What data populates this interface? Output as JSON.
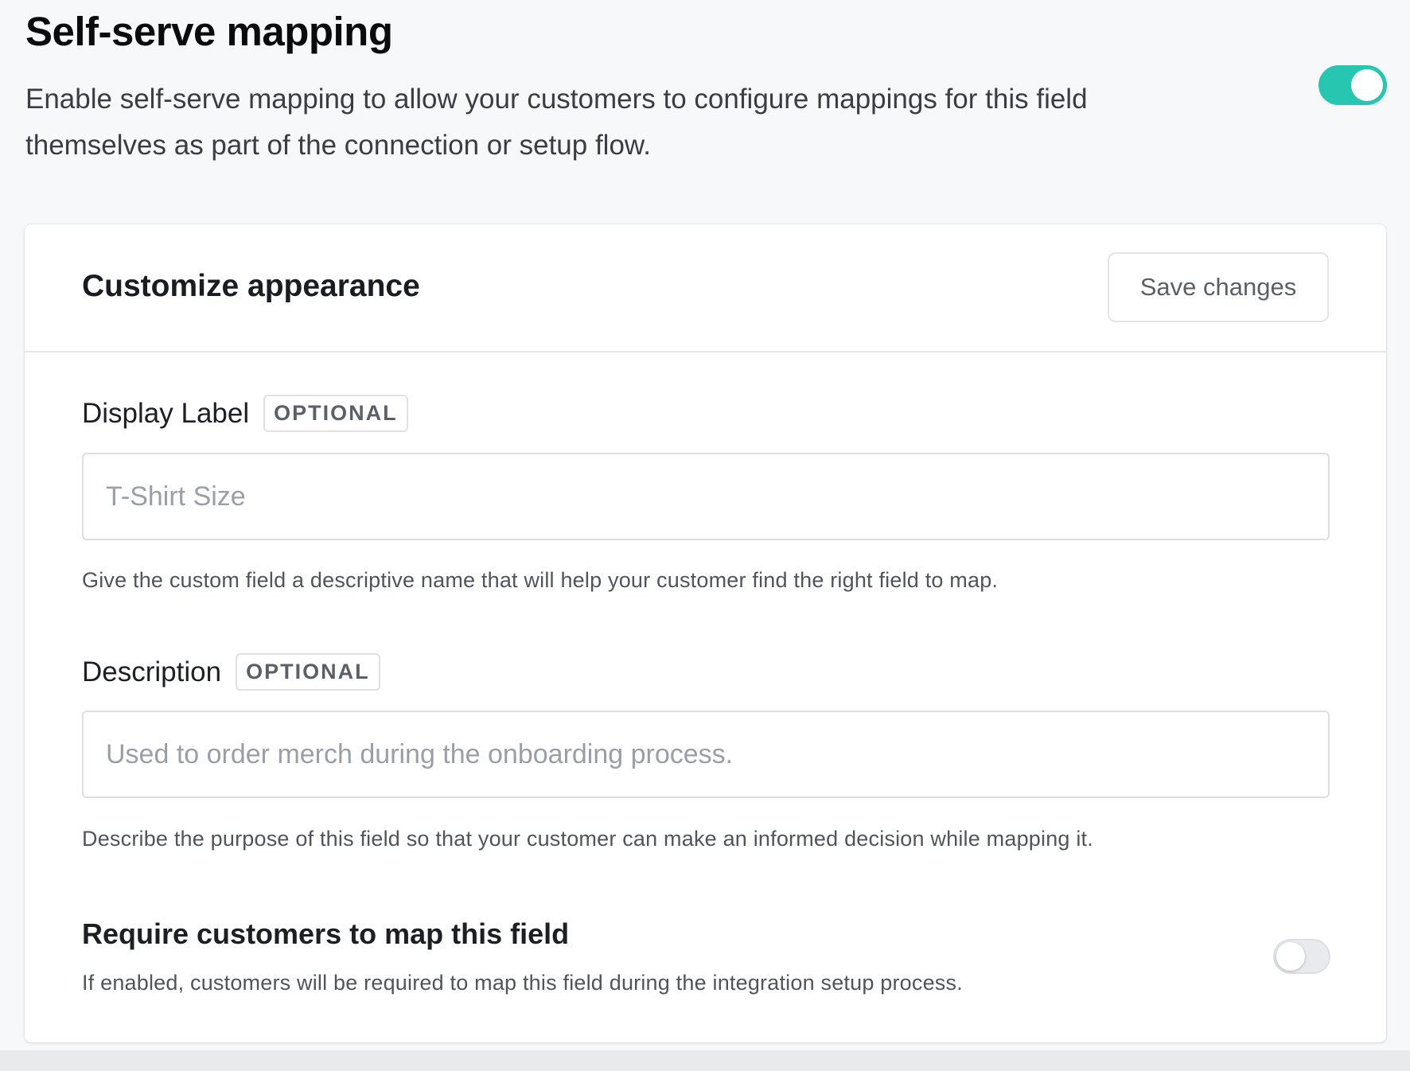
{
  "header": {
    "title": "Self-serve mapping",
    "description": "Enable self-serve mapping to allow your customers to configure mappings for this field themselves as part of the connection or setup flow.",
    "toggle_enabled": true
  },
  "card": {
    "title": "Customize appearance",
    "save_label": "Save changes",
    "display_label": {
      "label": "Display Label",
      "badge": "OPTIONAL",
      "placeholder": "T-Shirt Size",
      "help": "Give the custom field a descriptive name that will help your customer find the right field to map."
    },
    "description": {
      "label": "Description",
      "badge": "OPTIONAL",
      "placeholder": "Used to order merch during the onboarding process.",
      "help": "Describe the purpose of this field so that your customer can make an informed decision while mapping it."
    },
    "require": {
      "title": "Require customers to map this field",
      "help": "If enabled, customers will be required to map this field during the integration setup process.",
      "toggle_enabled": false
    }
  },
  "colors": {
    "toggle_on": "#26c6b0",
    "toggle_off": "#e9eaed"
  }
}
